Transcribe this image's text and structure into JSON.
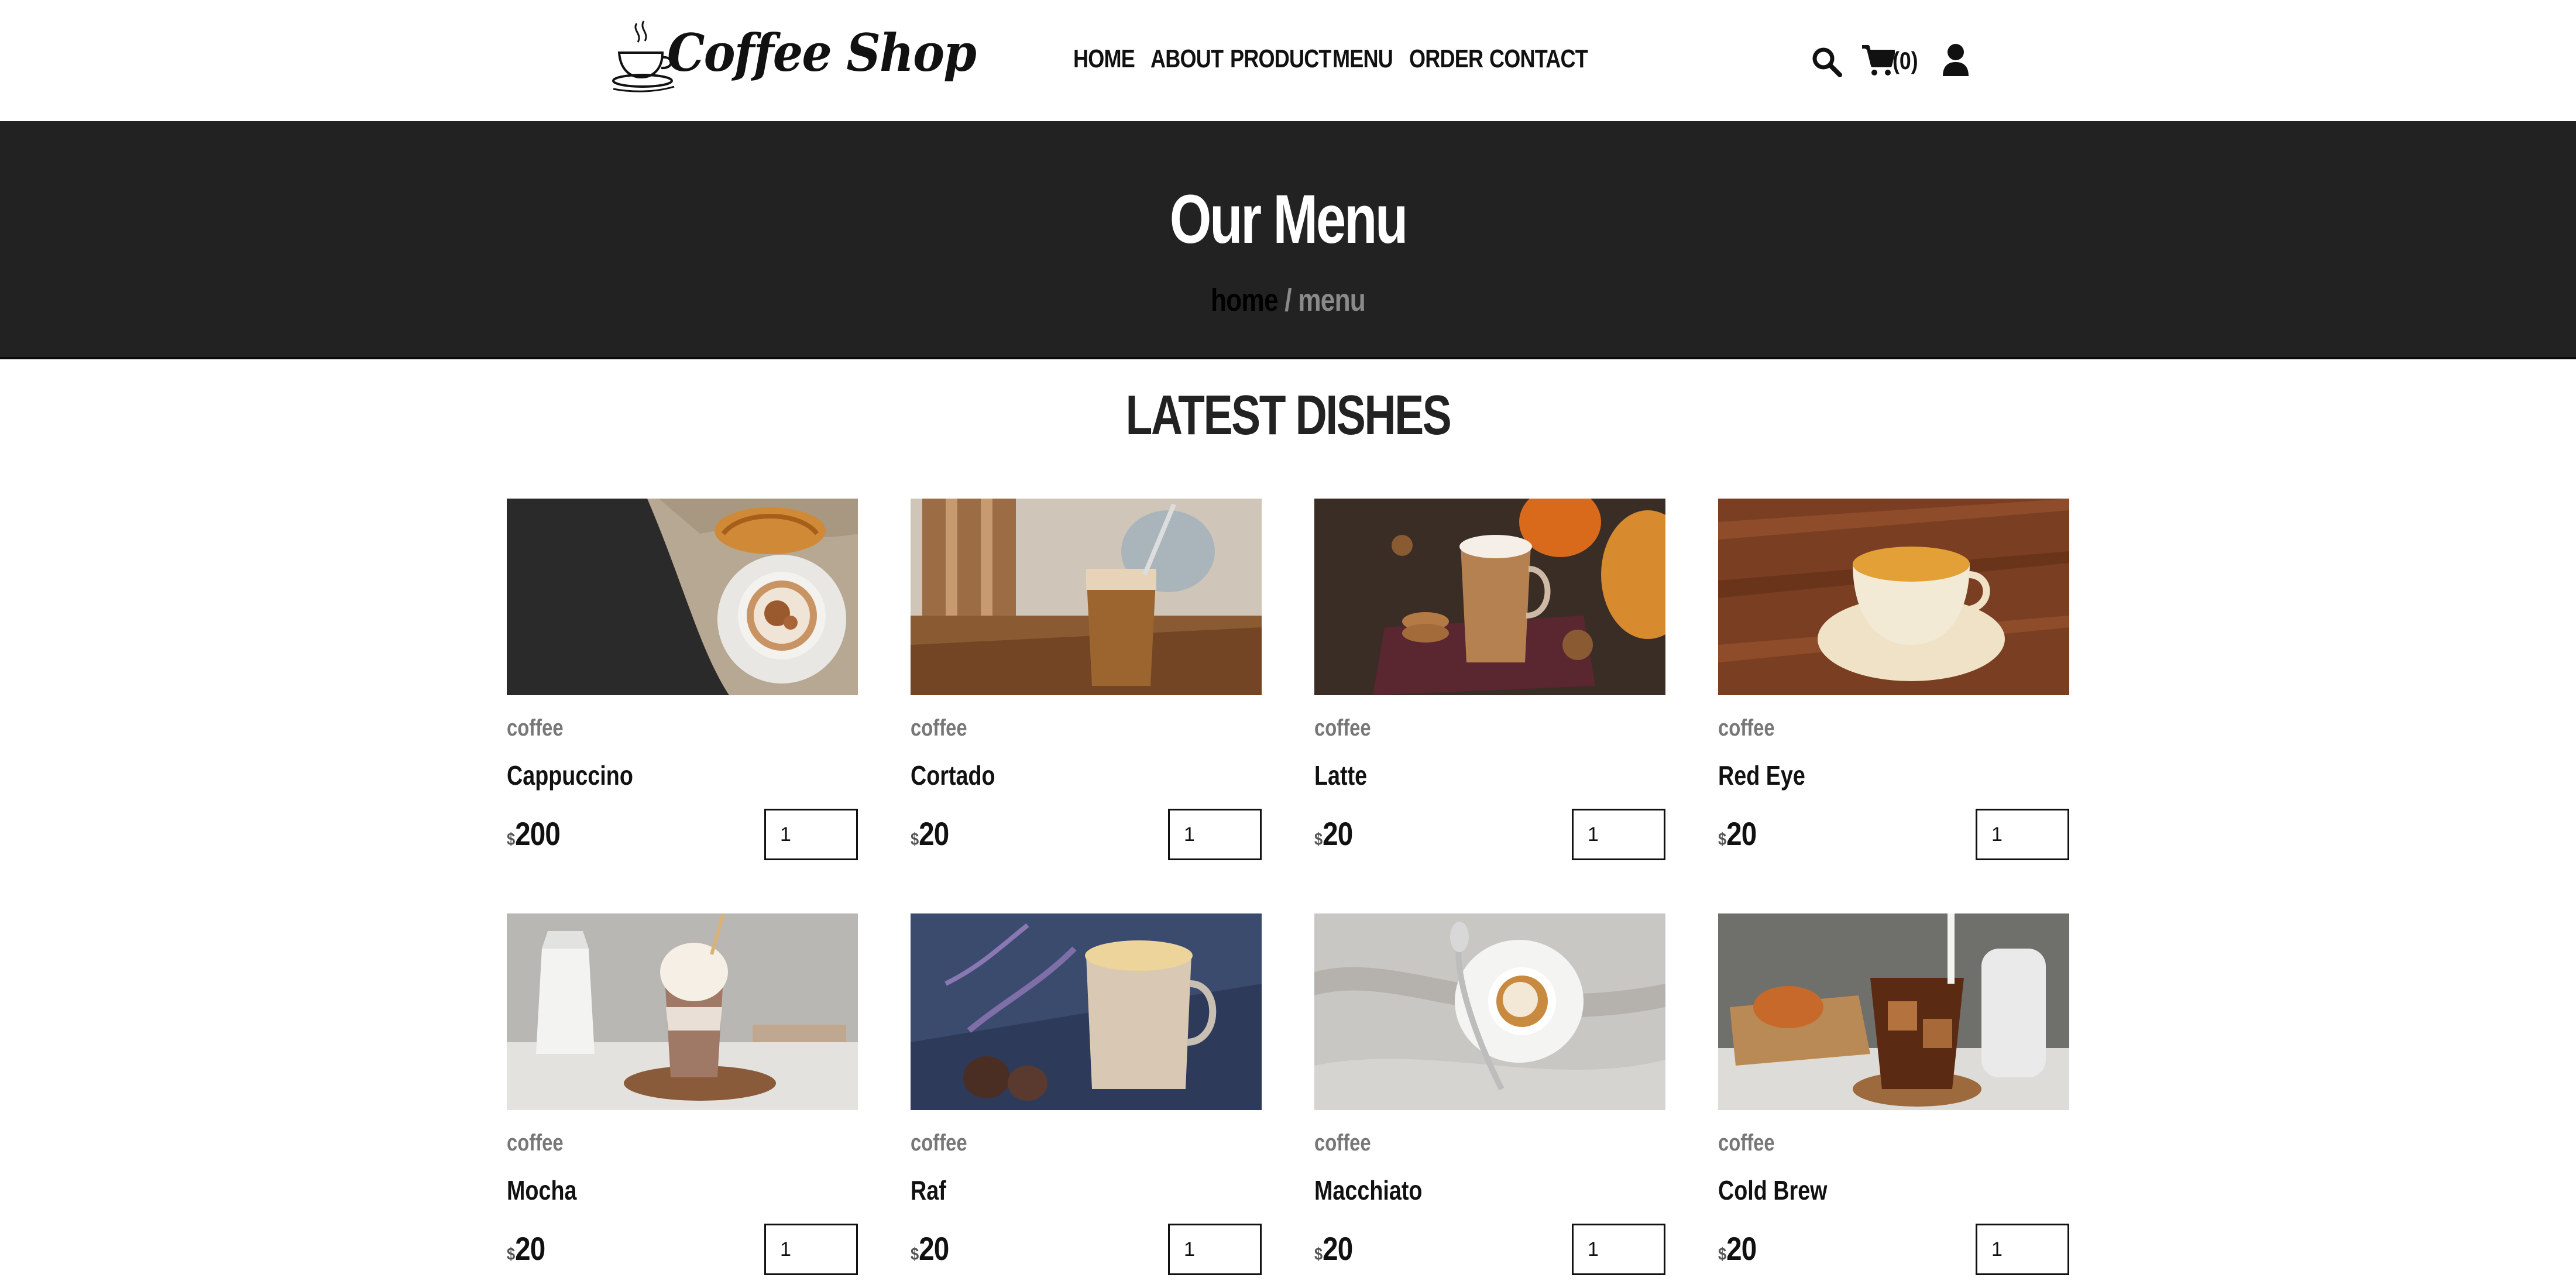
{
  "header": {
    "logo_text": "Coffee Shop",
    "nav": [
      "HOME",
      "ABOUT",
      "PRODUCT",
      "MENU",
      "ORDER",
      "CONTACT"
    ],
    "cart_count": "(0)",
    "icons": [
      "search-icon",
      "cart-icon",
      "user-icon"
    ]
  },
  "banner": {
    "title": "Our Menu",
    "breadcrumb_home": "home",
    "breadcrumb_sep": " / ",
    "breadcrumb_current": "menu"
  },
  "section": {
    "title": "LATEST DISHES"
  },
  "products": [
    {
      "category": "coffee",
      "name": "Cappuccino",
      "currency": "$",
      "price": "200",
      "qty": "1"
    },
    {
      "category": "coffee",
      "name": "Cortado",
      "currency": "$",
      "price": "20",
      "qty": "1"
    },
    {
      "category": "coffee",
      "name": "Latte",
      "currency": "$",
      "price": "20",
      "qty": "1"
    },
    {
      "category": "coffee",
      "name": "Red Eye",
      "currency": "$",
      "price": "20",
      "qty": "1"
    },
    {
      "category": "coffee",
      "name": "Mocha",
      "currency": "$",
      "price": "20",
      "qty": "1"
    },
    {
      "category": "coffee",
      "name": "Raf",
      "currency": "$",
      "price": "20",
      "qty": "1"
    },
    {
      "category": "coffee",
      "name": "Macchiato",
      "currency": "$",
      "price": "20",
      "qty": "1"
    },
    {
      "category": "coffee",
      "name": "Cold Brew",
      "currency": "$",
      "price": "20",
      "qty": "1"
    }
  ],
  "colors": {
    "banner_bg": "#222222",
    "text": "#111111",
    "muted": "#777777",
    "page_bg": "#ffffff"
  }
}
